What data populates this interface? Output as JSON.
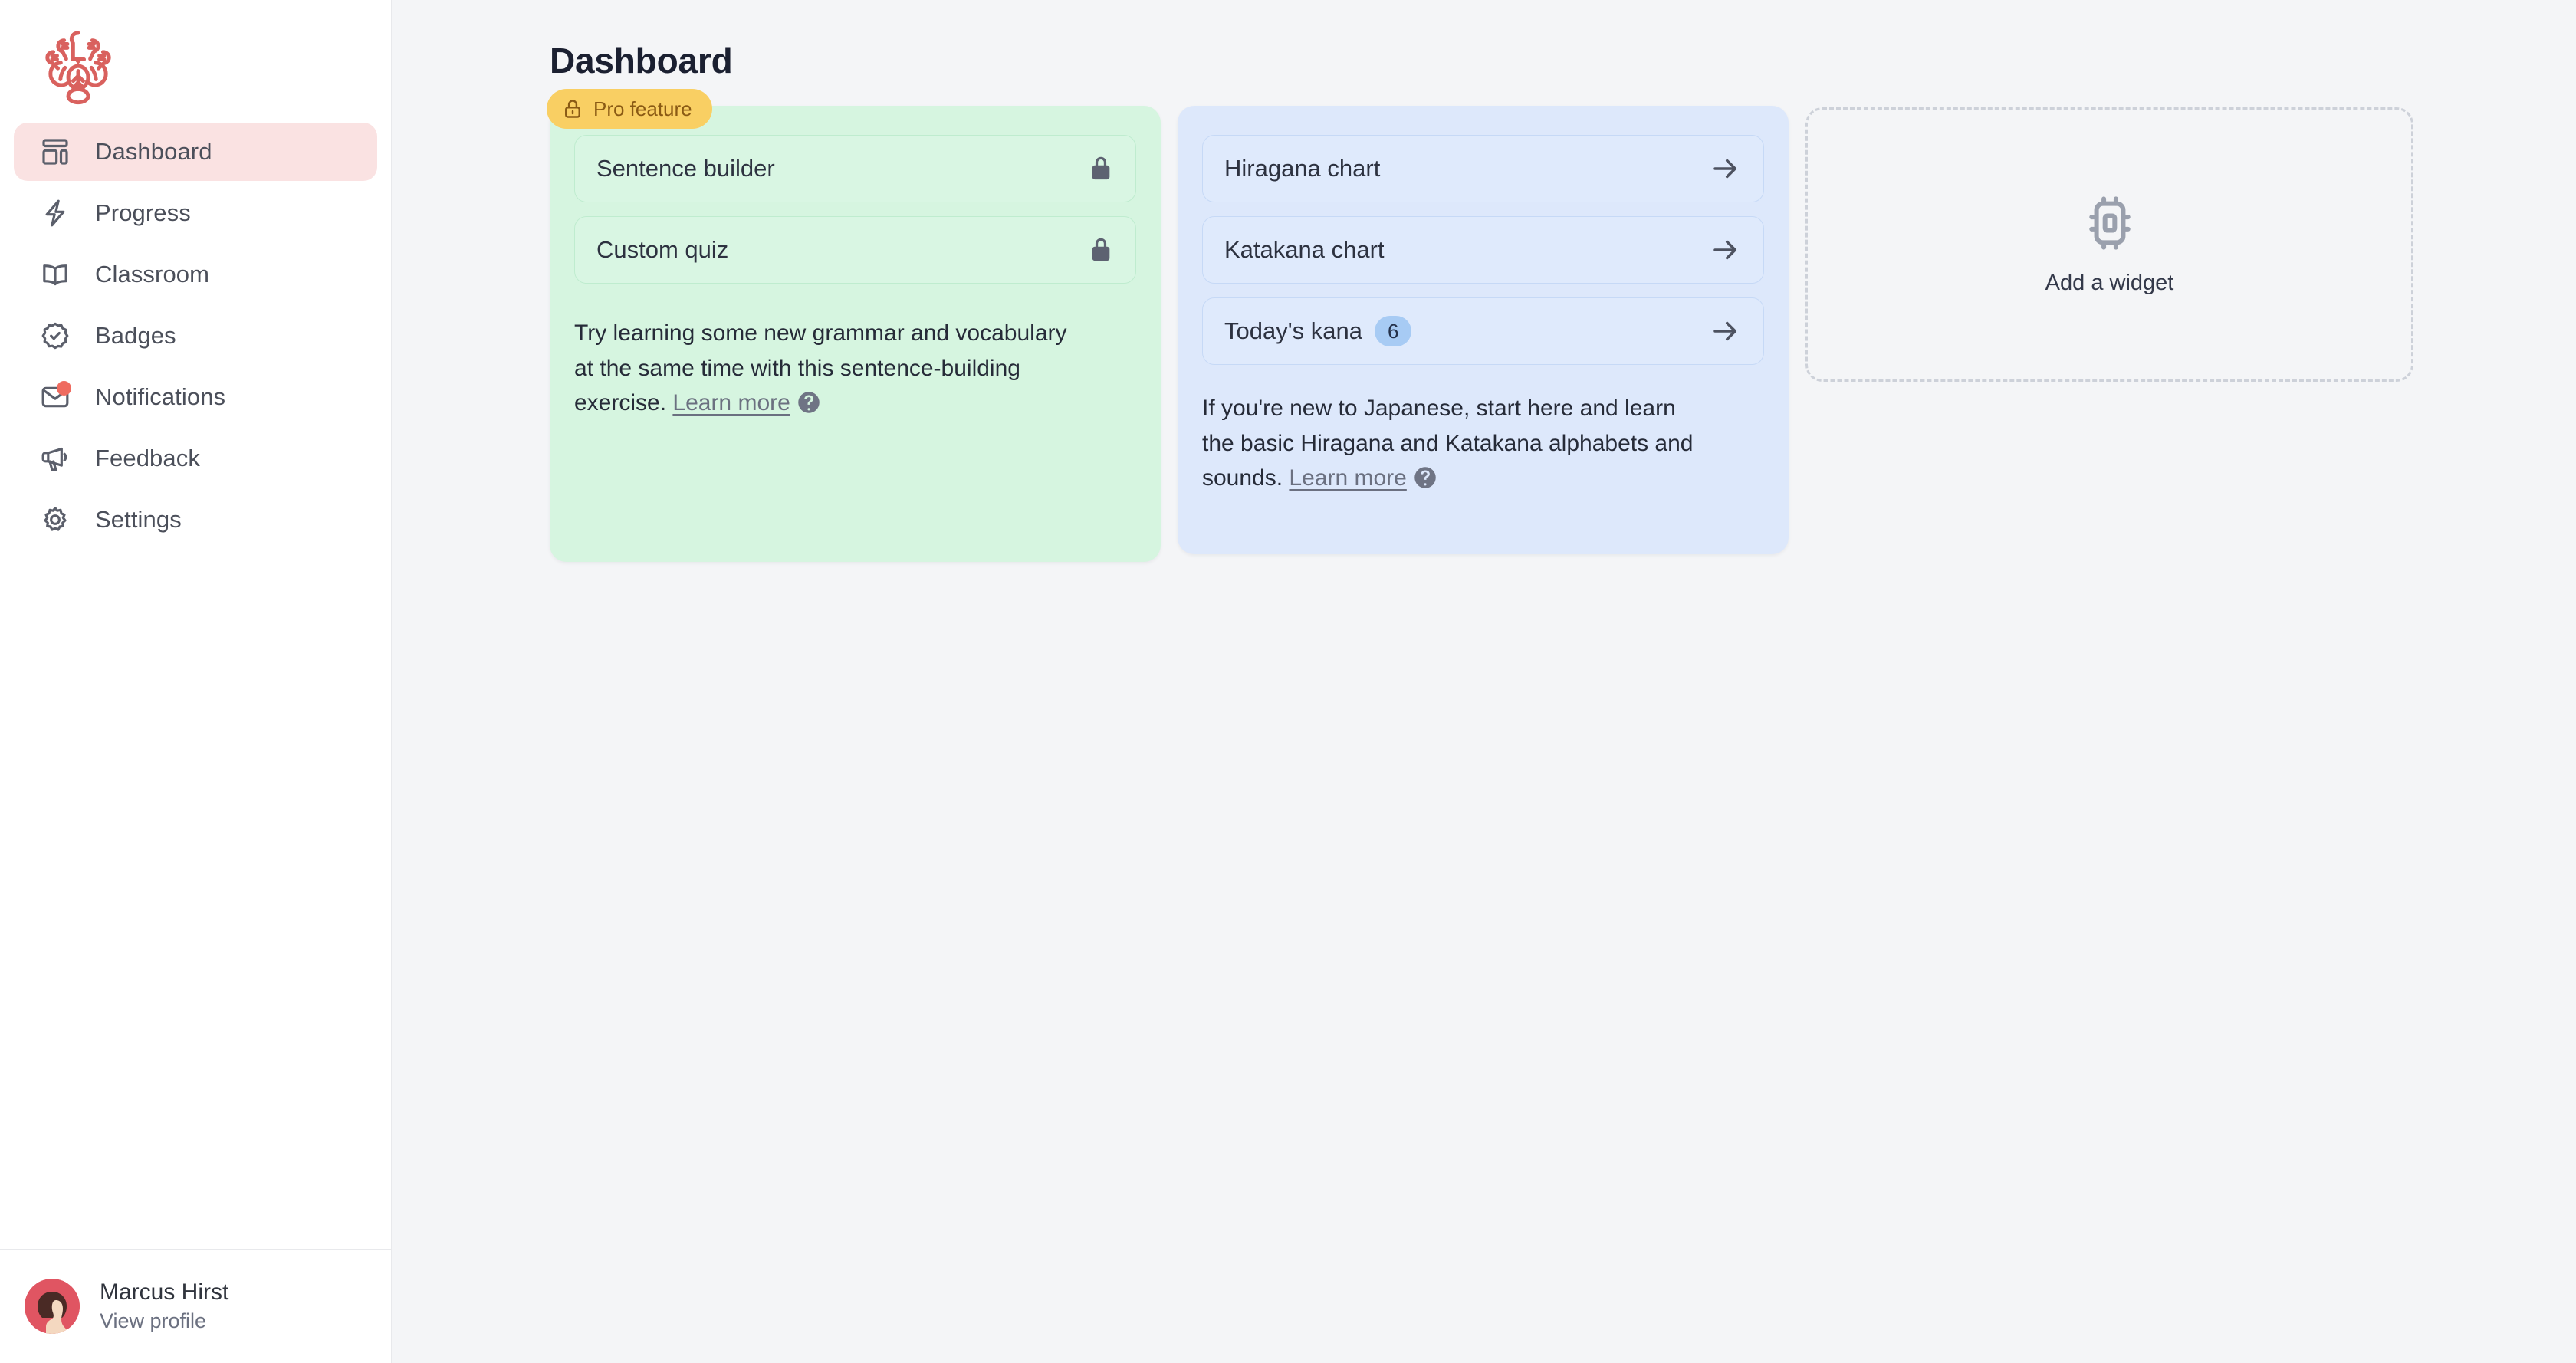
{
  "app": {
    "logo_icon": "kamon-crest-logo",
    "accent_color": "#d9615e",
    "background_color": "#f4f5f7"
  },
  "sidebar": {
    "items": [
      {
        "label": "Dashboard",
        "icon": "layout-dashboard-icon",
        "active": true,
        "has_dot": false
      },
      {
        "label": "Progress",
        "icon": "lightning-bolt-icon",
        "active": false,
        "has_dot": false
      },
      {
        "label": "Classroom",
        "icon": "open-book-icon",
        "active": false,
        "has_dot": false
      },
      {
        "label": "Badges",
        "icon": "badge-check-icon",
        "active": false,
        "has_dot": false
      },
      {
        "label": "Notifications",
        "icon": "envelope-icon",
        "active": false,
        "has_dot": true
      },
      {
        "label": "Feedback",
        "icon": "megaphone-icon",
        "active": false,
        "has_dot": false
      },
      {
        "label": "Settings",
        "icon": "gear-icon",
        "active": false,
        "has_dot": false
      }
    ],
    "profile": {
      "name": "Marcus Hirst",
      "action": "View profile",
      "avatar_icon": "user-avatar"
    }
  },
  "header": {
    "title": "Dashboard"
  },
  "cards": {
    "grammar": {
      "badge": {
        "label": "Pro feature",
        "icon": "lock-icon",
        "bg": "#f9cf63",
        "fg": "#8a5a14"
      },
      "color": "#d6f5e0",
      "rows": [
        {
          "label": "Sentence builder",
          "trailing_icon": "lock-icon",
          "badge": null
        },
        {
          "label": "Custom quiz",
          "trailing_icon": "lock-icon",
          "badge": null
        }
      ],
      "description": "Try learning some new grammar and vocabulary at the same time with this sentence-building exercise.",
      "link_label": "Learn more",
      "help_icon": "question-circle-icon"
    },
    "kana": {
      "color": "#dde8fb",
      "rows": [
        {
          "label": "Hiragana chart",
          "trailing_icon": "arrow-right-icon",
          "badge": null
        },
        {
          "label": "Katakana chart",
          "trailing_icon": "arrow-right-icon",
          "badge": null
        },
        {
          "label": "Today's kana",
          "trailing_icon": "arrow-right-icon",
          "badge": "6"
        }
      ],
      "description": "If you're new to Japanese, start here and learn the basic Hiragana and Katakana alphabets and sounds.",
      "link_label": "Learn more",
      "help_icon": "question-circle-icon"
    },
    "add_widget": {
      "label": "Add a widget",
      "icon": "cpu-chip-icon"
    }
  }
}
